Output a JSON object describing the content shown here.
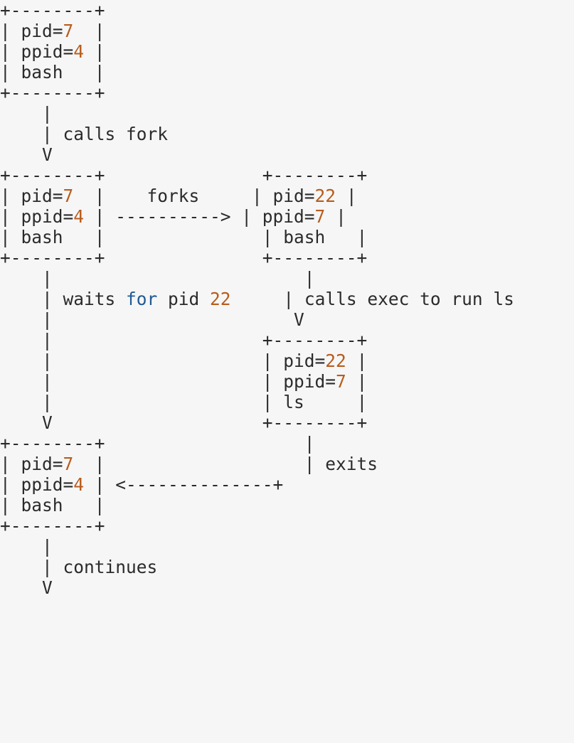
{
  "colors": {
    "background": "#f6f6f6",
    "text": "#2b2b2b",
    "number": "#b85c1e",
    "keyword": "#1f5a96"
  },
  "lines": [
    [
      {
        "t": "+--------+"
      }
    ],
    [
      {
        "t": "| pid="
      },
      {
        "t": "7",
        "c": "num"
      },
      {
        "t": "  |"
      }
    ],
    [
      {
        "t": "| ppid="
      },
      {
        "t": "4",
        "c": "num"
      },
      {
        "t": " |"
      }
    ],
    [
      {
        "t": "| bash   |"
      }
    ],
    [
      {
        "t": "+--------+"
      }
    ],
    [
      {
        "t": "    |"
      }
    ],
    [
      {
        "t": "    | calls fork"
      }
    ],
    [
      {
        "t": "    V"
      }
    ],
    [
      {
        "t": "+--------+               +--------+"
      }
    ],
    [
      {
        "t": "| pid="
      },
      {
        "t": "7",
        "c": "num"
      },
      {
        "t": "  |    forks     | pid="
      },
      {
        "t": "22",
        "c": "num"
      },
      {
        "t": " |"
      }
    ],
    [
      {
        "t": "| ppid="
      },
      {
        "t": "4",
        "c": "num"
      },
      {
        "t": " | ----------> | ppid="
      },
      {
        "t": "7",
        "c": "num"
      },
      {
        "t": " |"
      }
    ],
    [
      {
        "t": "| bash   |               | bash   |"
      }
    ],
    [
      {
        "t": "+--------+               +--------+"
      }
    ],
    [
      {
        "t": "    |                        |"
      }
    ],
    [
      {
        "t": "    | waits "
      },
      {
        "t": "for",
        "c": "kw"
      },
      {
        "t": " pid "
      },
      {
        "t": "22",
        "c": "num"
      },
      {
        "t": "     | calls exec to run ls"
      }
    ],
    [
      {
        "t": "    |                       V"
      }
    ],
    [
      {
        "t": "    |                    +--------+"
      }
    ],
    [
      {
        "t": "    |                    | pid="
      },
      {
        "t": "22",
        "c": "num"
      },
      {
        "t": " |"
      }
    ],
    [
      {
        "t": "    |                    | ppid="
      },
      {
        "t": "7",
        "c": "num"
      },
      {
        "t": " |"
      }
    ],
    [
      {
        "t": "    |                    | ls     |"
      }
    ],
    [
      {
        "t": "    V                    +--------+"
      }
    ],
    [
      {
        "t": "+--------+                   |"
      }
    ],
    [
      {
        "t": "| pid="
      },
      {
        "t": "7",
        "c": "num"
      },
      {
        "t": "  |                   | exits"
      }
    ],
    [
      {
        "t": "| ppid="
      },
      {
        "t": "4",
        "c": "num"
      },
      {
        "t": " | <--------------+"
      }
    ],
    [
      {
        "t": "| bash   |"
      }
    ],
    [
      {
        "t": "+--------+"
      }
    ],
    [
      {
        "t": "    |"
      }
    ],
    [
      {
        "t": "    | continues"
      }
    ],
    [
      {
        "t": "    V"
      }
    ]
  ]
}
